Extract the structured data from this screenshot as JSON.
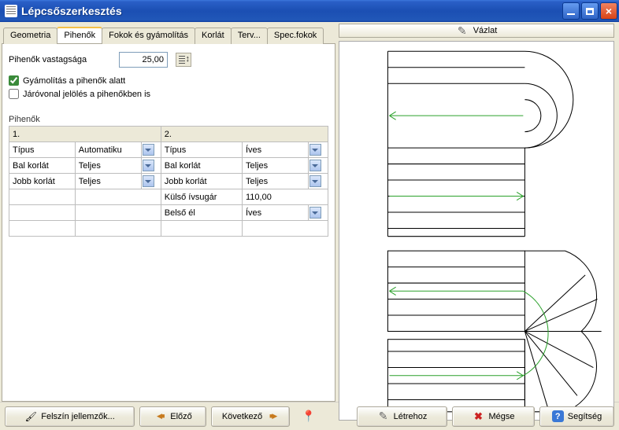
{
  "window": {
    "title": "Lépcsőszerkesztés"
  },
  "tabs": {
    "items": [
      "Geometria",
      "Pihenők",
      "Fokok és gyámolítás",
      "Korlát",
      "Terv...",
      "Spec.fokok"
    ],
    "active_index": 1
  },
  "form": {
    "thickness_label": "Pihenők vastagsága",
    "thickness_value": "25,00",
    "chk1_label": "Gyámolítás a pihenők alatt",
    "chk1_checked": true,
    "chk2_label": "Járóvonal jelölés a pihenőkben is",
    "chk2_checked": false,
    "section_label": "Pihenők"
  },
  "table": {
    "group_headers": [
      "1.",
      "2."
    ],
    "rows": [
      {
        "c1_label": "Típus",
        "c1_value": "Automatiku",
        "c1_dd": true,
        "c2_label": "Típus",
        "c2_value": "Íves",
        "c2_dd": true
      },
      {
        "c1_label": "Bal korlát",
        "c1_value": "Teljes",
        "c1_dd": true,
        "c2_label": "Bal korlát",
        "c2_value": "Teljes",
        "c2_dd": true
      },
      {
        "c1_label": "Jobb korlát",
        "c1_value": "Teljes",
        "c1_dd": true,
        "c2_label": "Jobb korlát",
        "c2_value": "Teljes",
        "c2_dd": true
      },
      {
        "c1_label": "",
        "c1_value": "",
        "c1_dd": false,
        "c2_label": "Külső ívsugár",
        "c2_value": "110,00",
        "c2_dd": false
      },
      {
        "c1_label": "",
        "c1_value": "",
        "c1_dd": false,
        "c2_label": "Belső él",
        "c2_value": "Íves",
        "c2_dd": true
      },
      {
        "c1_label": "",
        "c1_value": "",
        "c1_dd": false,
        "c2_label": "",
        "c2_value": "",
        "c2_dd": false
      }
    ]
  },
  "sketch": {
    "button_label": "Vázlat"
  },
  "buttons": {
    "surface_props": "Felszín jellemzők...",
    "prev": "Előző",
    "next": "Következő",
    "create": "Létrehoz",
    "cancel": "Mégse",
    "help": "Segítség"
  }
}
